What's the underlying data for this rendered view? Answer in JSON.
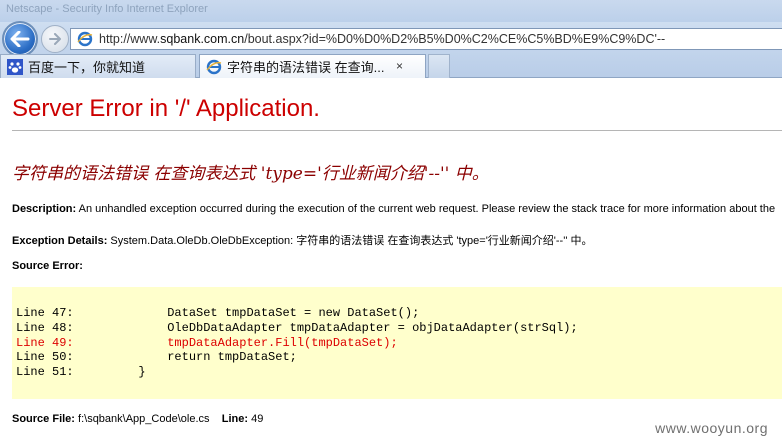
{
  "browser": {
    "title_ghost": "Netscape - Security Info Internet Explorer",
    "address": {
      "url_prefix": "http://www.",
      "url_domain": "sqbank.com.cn",
      "url_rest": "/bout.aspx?id=%D0%D0%D2%B5%D0%C2%CE%C5%BD%E9%C9%DC'--"
    },
    "tabs": [
      {
        "label": "百度一下，你就知道"
      },
      {
        "label": "字符串的语法错误 在查询...",
        "close": "×"
      }
    ]
  },
  "page": {
    "title": "Server Error in '/' Application.",
    "error_message": "字符串的语法错误 在查询表达式 'type='行业新闻介绍'--'' 中。",
    "description_label": "Description:",
    "description_text": " An unhandled exception occurred during the execution of the current web request. Please review the stack trace for more information about the",
    "exception_label": "Exception Details:",
    "exception_text": " System.Data.OleDb.OleDbException: 字符串的语法错误 在查询表达式 'type='行业新闻介绍'--'' 中。",
    "source_error_label": "Source Error:",
    "code_lines": [
      {
        "prefix": "Line 47:",
        "code": "             DataSet tmpDataSet = new DataSet();"
      },
      {
        "prefix": "Line 48:",
        "code": "             OleDbDataAdapter tmpDataAdapter = objDataAdapter(strSql);"
      },
      {
        "prefix": "Line 49:",
        "code": "             tmpDataAdapter.Fill(tmpDataSet);"
      },
      {
        "prefix": "Line 50:",
        "code": "             return tmpDataSet;"
      },
      {
        "prefix": "Line 51:",
        "code": "         }"
      }
    ],
    "source_file_label": "Source File:",
    "source_file_value": " f:\\sqbank\\App_Code\\ole.cs",
    "line_label": "Line:",
    "line_value": " 49",
    "watermark": "www.wooyun.org"
  }
}
